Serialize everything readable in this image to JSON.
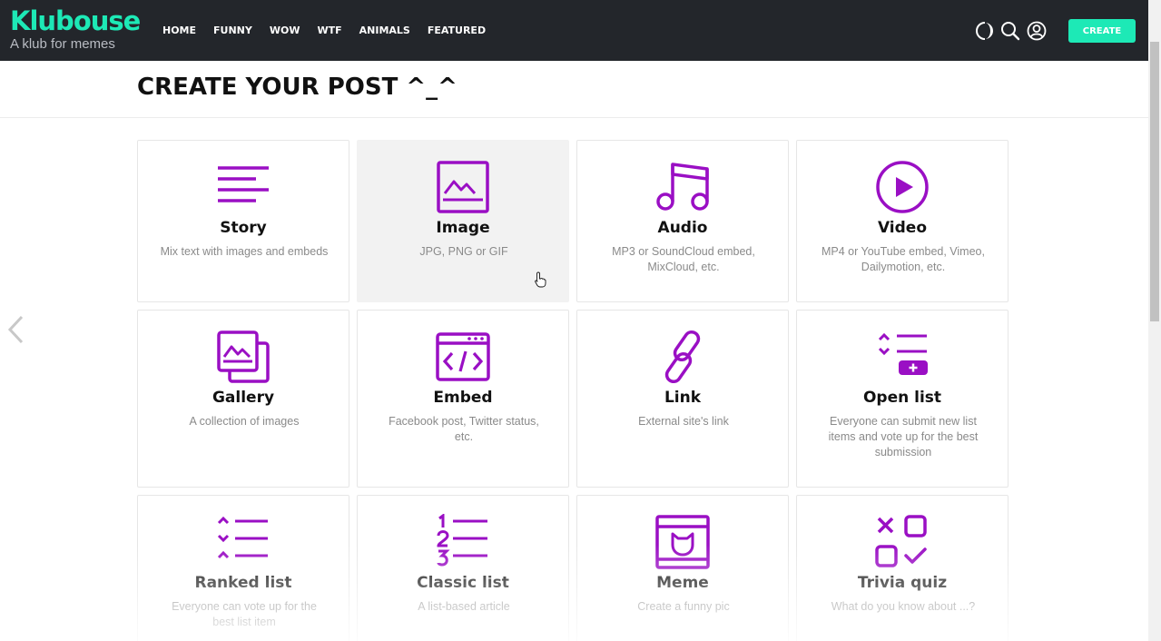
{
  "brand": {
    "name": "Klubouse",
    "tagline": "A klub for memes",
    "accent_color": "#1de9b6",
    "icon_color": "#9a0fc4",
    "navbar_color": "#23262b"
  },
  "nav": {
    "items": [
      "HOME",
      "FUNNY",
      "WOW",
      "WTF",
      "ANIMALS",
      "FEATURED"
    ],
    "icons": [
      "dark-mode-icon",
      "search-icon",
      "user-icon"
    ],
    "create_label": "CREATE"
  },
  "page": {
    "title": "CREATE YOUR POST ^_^"
  },
  "post_types": [
    {
      "title": "Story",
      "desc": "Mix text with images and embeds",
      "icon": "story-icon"
    },
    {
      "title": "Image",
      "desc": "JPG, PNG or GIF",
      "icon": "image-icon"
    },
    {
      "title": "Audio",
      "desc": "MP3 or SoundCloud embed, MixCloud, etc.",
      "icon": "audio-icon"
    },
    {
      "title": "Video",
      "desc": "MP4 or YouTube embed, Vimeo, Dailymotion, etc.",
      "icon": "video-icon"
    },
    {
      "title": "Gallery",
      "desc": "A collection of images",
      "icon": "gallery-icon"
    },
    {
      "title": "Embed",
      "desc": "Facebook post, Twitter status, etc.",
      "icon": "embed-icon"
    },
    {
      "title": "Link",
      "desc": "External site's link",
      "icon": "link-icon"
    },
    {
      "title": "Open list",
      "desc": "Everyone can submit new list items and vote up for the best submission",
      "icon": "open-list-icon"
    },
    {
      "title": "Ranked list",
      "desc": "Everyone can vote up for the best list item",
      "icon": "ranked-list-icon"
    },
    {
      "title": "Classic list",
      "desc": "A list-based article",
      "icon": "classic-list-icon"
    },
    {
      "title": "Meme",
      "desc": "Create a funny pic",
      "icon": "meme-icon"
    },
    {
      "title": "Trivia quiz",
      "desc": "What do you know about ...?",
      "icon": "trivia-quiz-icon"
    }
  ]
}
